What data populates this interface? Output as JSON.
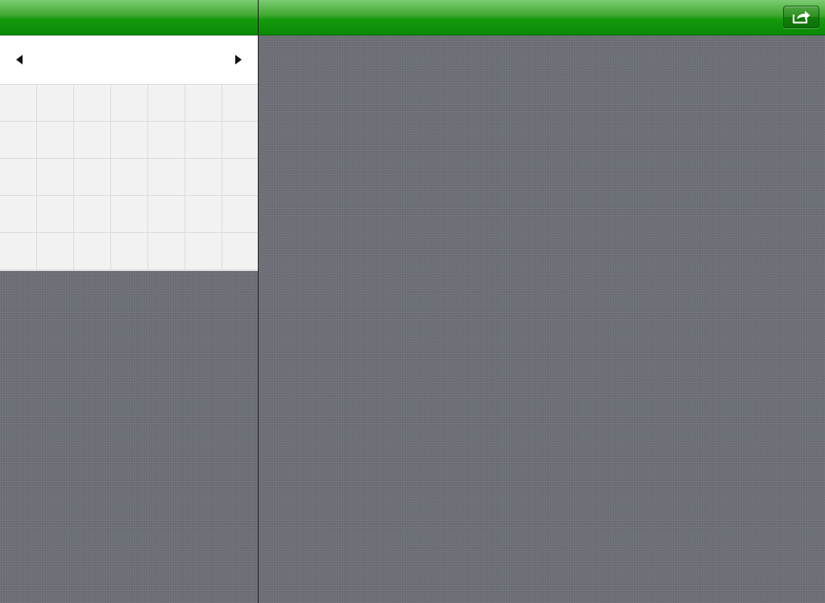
{
  "calendar_nav": {
    "title": "",
    "prev_icon": "triangle-left-icon",
    "next_icon": "triangle-right-icon",
    "month_label": ""
  },
  "calendar": {
    "rows": 5,
    "columns": 7
  },
  "detail_nav": {
    "title": "",
    "share_icon": "share-arrow-icon"
  },
  "colors": {
    "navbar_green": "#159a0c",
    "linen_gray": "#6e7179",
    "grid_bg": "#f2f2f2"
  }
}
